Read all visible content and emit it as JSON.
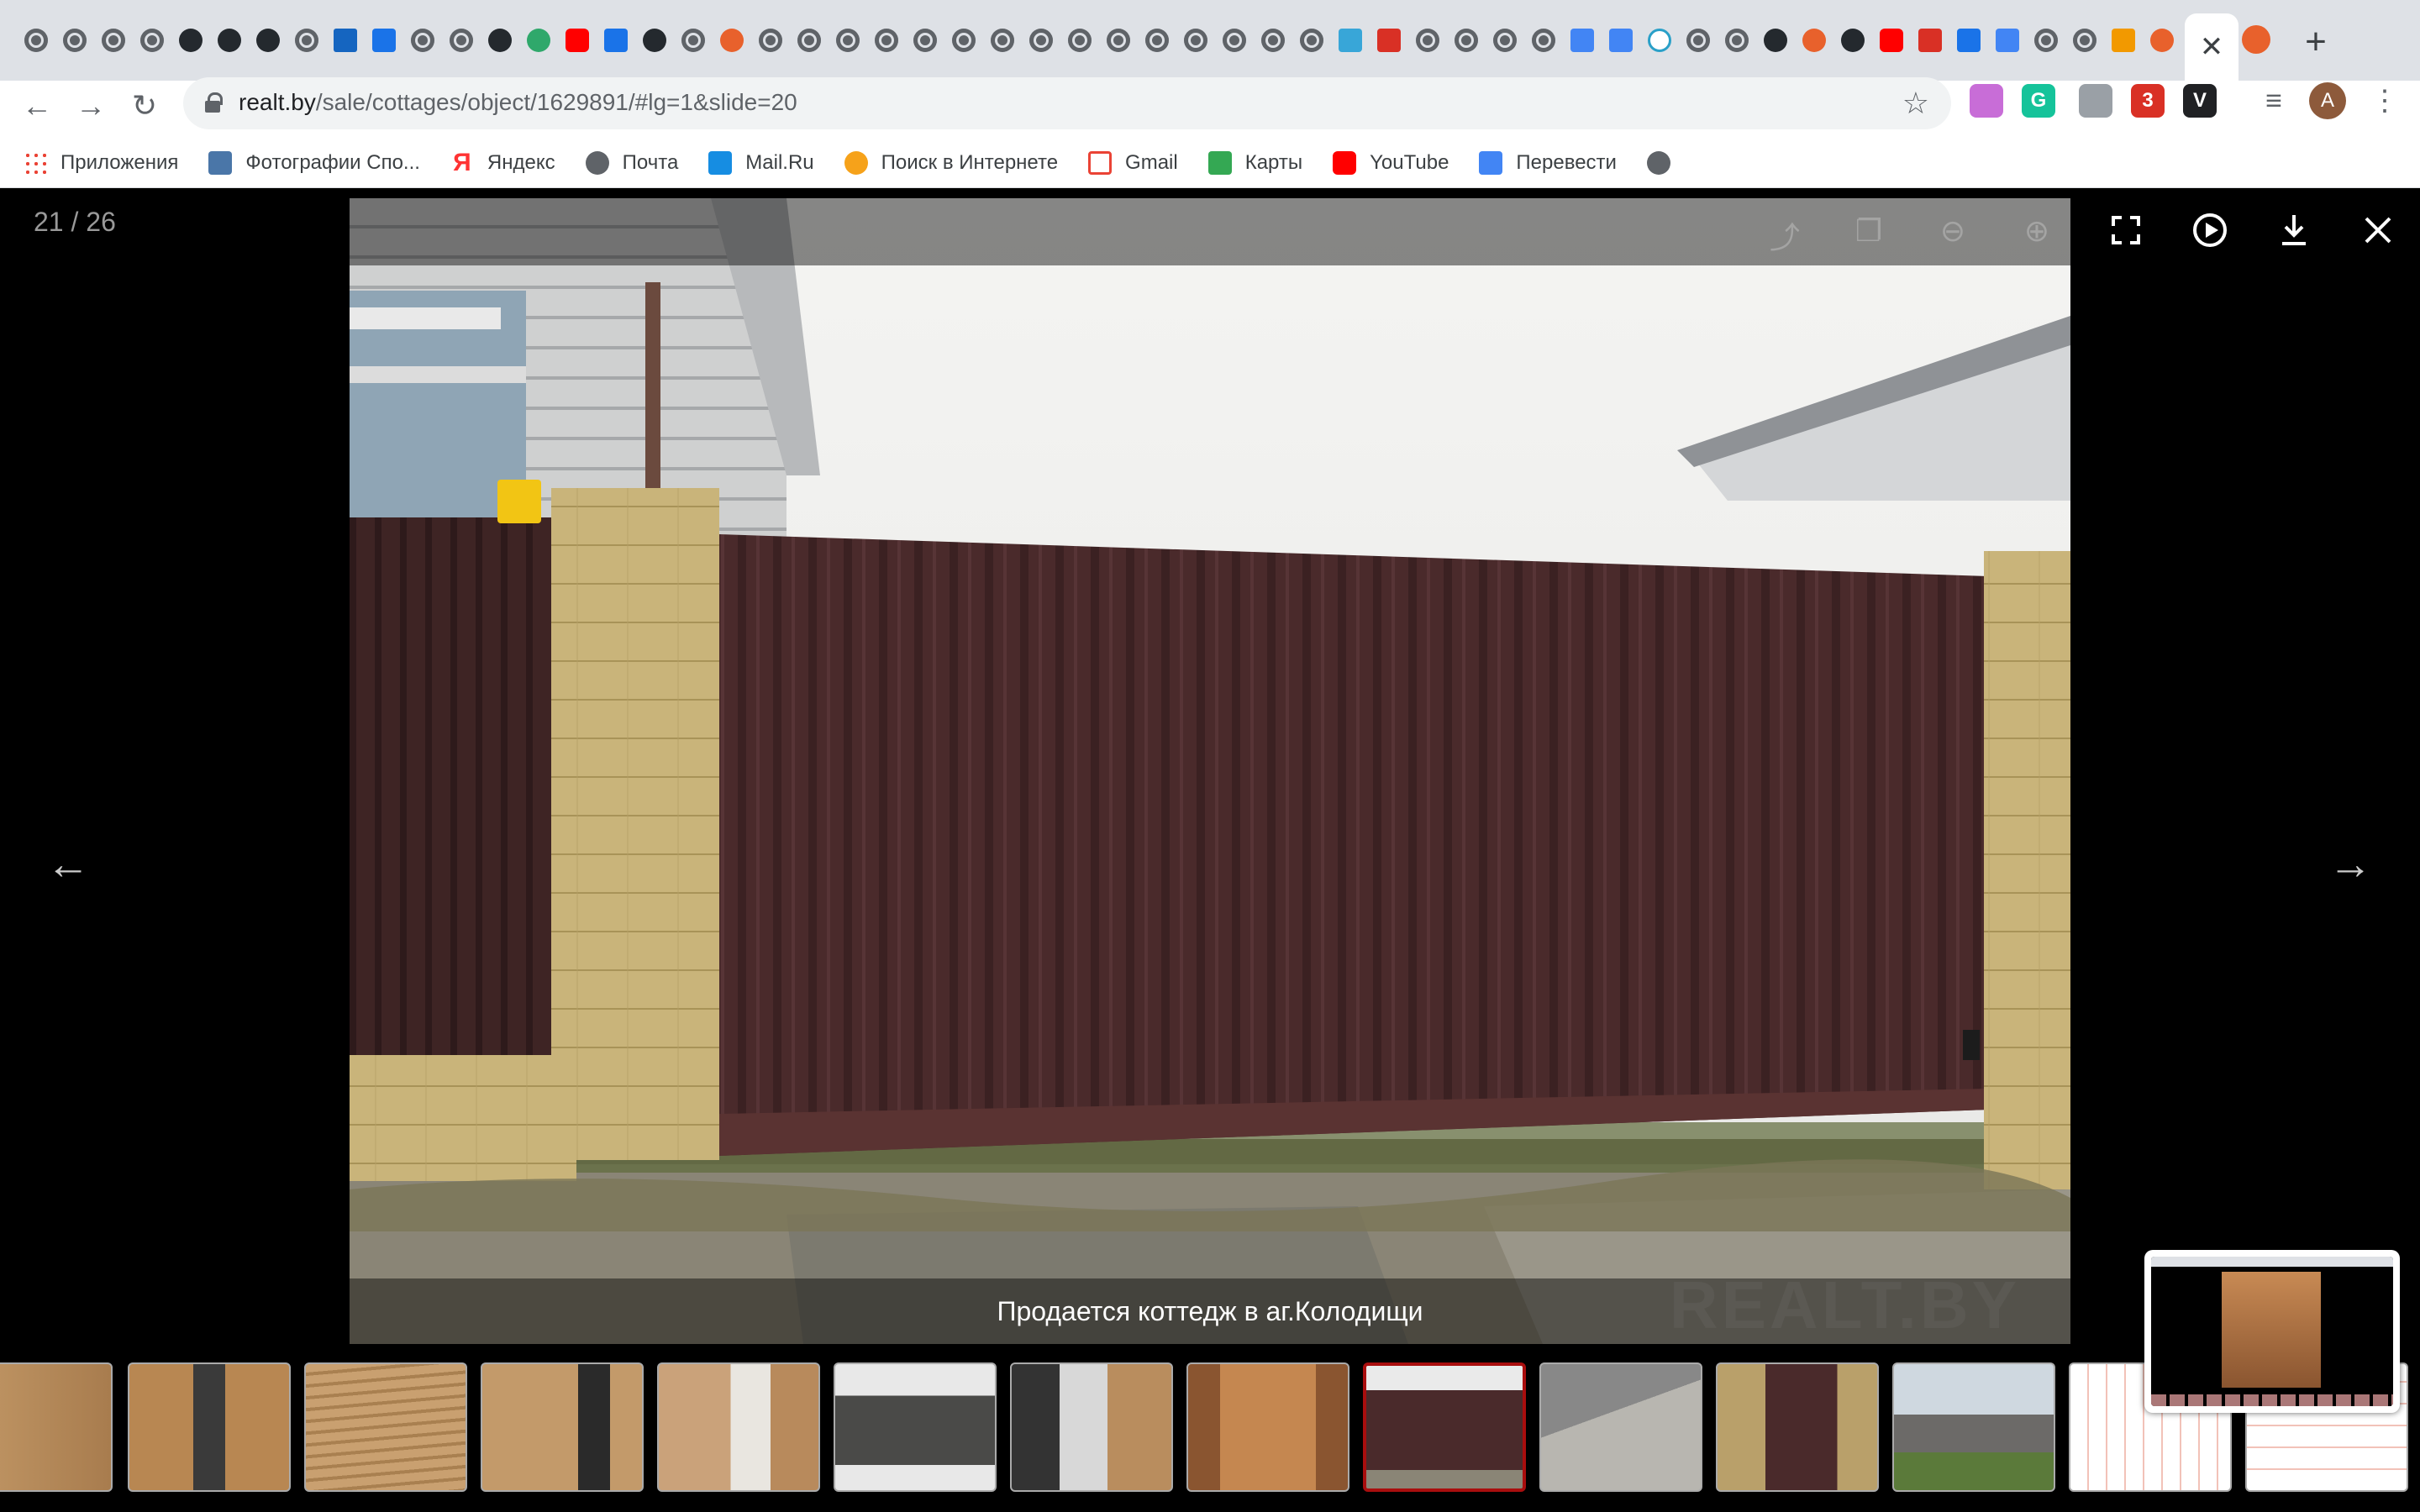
{
  "browser": {
    "active_tab_close": "✕",
    "new_tab": "+",
    "tab_icons": [
      "globe",
      "globe",
      "globe",
      "globe",
      "github",
      "github",
      "github",
      "globe",
      "mail",
      "cap",
      "globe",
      "globe",
      "github",
      "green",
      "youtube",
      "cap",
      "github",
      "globe",
      "realt",
      "globe",
      "globe",
      "globe",
      "globe",
      "globe",
      "globe",
      "globe",
      "globe",
      "globe",
      "globe",
      "globe",
      "globe",
      "globe",
      "globe",
      "globe",
      "cyan",
      "red2",
      "globe",
      "globe",
      "globe",
      "globe",
      "docs",
      "docs",
      "react",
      "globe",
      "globe",
      "github",
      "realt",
      "github",
      "youtube",
      "red2",
      "cap",
      "docs",
      "globe",
      "globe",
      "orange",
      "realt",
      "realt"
    ],
    "url": {
      "host": "realt.by",
      "path": "/sale/cottages/object/1629891/#lg=1&slide=20"
    },
    "extensions": [
      {
        "icon": "gradient-ext-icon",
        "label": "",
        "color": "#c86dd7"
      },
      {
        "icon": "grammarly-icon",
        "label": "G",
        "color": "#15c39a"
      },
      {
        "icon": "paw-icon",
        "label": "",
        "color": "#9aa0a6"
      },
      {
        "icon": "adblock-icon",
        "label": "3",
        "color": "#d93025"
      },
      {
        "icon": "v-icon",
        "label": "V",
        "color": "#202124"
      }
    ],
    "avatar_letter": "A",
    "bookmarks": [
      {
        "icon": "apps",
        "label": "Приложения"
      },
      {
        "icon": "vk",
        "label": "Фотографии Спо..."
      },
      {
        "icon": "ya",
        "label": "Яндекс"
      },
      {
        "icon": "globe",
        "label": "Почта"
      },
      {
        "icon": "mailru",
        "label": "Mail.Ru"
      },
      {
        "icon": "search",
        "label": "Поиск в Интернете"
      },
      {
        "icon": "gmail",
        "label": "Gmail"
      },
      {
        "icon": "maps",
        "label": "Карты"
      },
      {
        "icon": "yt",
        "label": "YouTube"
      },
      {
        "icon": "translate",
        "label": "Перевести"
      },
      {
        "icon": "globe",
        "label": ""
      }
    ]
  },
  "gallery": {
    "counter": "21 / 26",
    "caption": "Продается коттедж в аг.Колодищи",
    "watermark": "REALT.BY",
    "active_thumbnail_index": 8,
    "thumbnails": [
      "wood-room",
      "wood-room-window",
      "wood-ceiling",
      "wood-door",
      "boiler-room",
      "window-frame",
      "balcony",
      "bathroom",
      "gate",
      "gate-side",
      "door-brown",
      "house-exterior",
      "floor-plan",
      "floor-plan-2"
    ]
  },
  "icons": {
    "fullscreen": "⛶",
    "play": "▶",
    "download": "⤓",
    "close": "✕",
    "prev": "←",
    "next": "→",
    "back": "←",
    "forward": "→",
    "reload": "↻",
    "star": "☆",
    "menu": "⋮"
  }
}
